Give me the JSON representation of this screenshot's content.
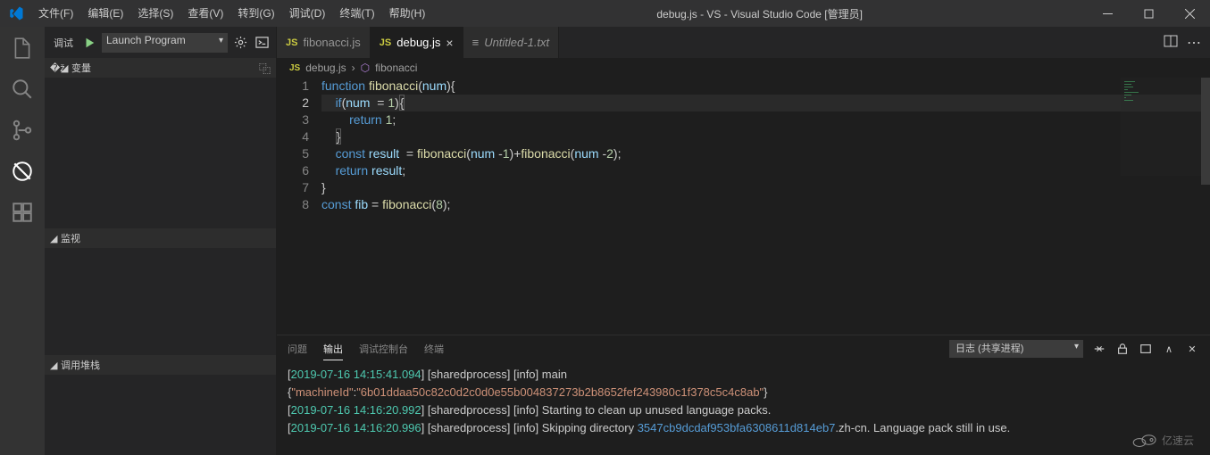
{
  "title": "debug.js - VS - Visual Studio Code [管理员]",
  "menu": [
    "文件(F)",
    "编辑(E)",
    "选择(S)",
    "查看(V)",
    "转到(G)",
    "调试(D)",
    "终端(T)",
    "帮助(H)"
  ],
  "debug": {
    "label": "调试",
    "config": "Launch Program"
  },
  "sections": {
    "vars": "变量",
    "watch": "监视",
    "callstack": "调用堆栈"
  },
  "tabs": [
    {
      "icon": "JS",
      "label": "fibonacci.js",
      "active": false,
      "close": false,
      "italic": false
    },
    {
      "icon": "JS",
      "label": "debug.js",
      "active": true,
      "close": true,
      "italic": false
    },
    {
      "icon": "≡",
      "label": "Untitled-1.txt",
      "active": false,
      "close": false,
      "italic": true
    }
  ],
  "breadcrumb": {
    "file": "debug.js",
    "symbol": "fibonacci"
  },
  "code": {
    "lines": [
      {
        "n": 1,
        "html": "<span class='kw'>function</span> <span class='fn'>fibonacci</span>(<span class='vn'>num</span>){"
      },
      {
        "n": 2,
        "html": "    <span class='kw'>if</span>(<span class='vn'>num</span>  = <span class='nm'>1</span>)<span class='cur-bracket'>{</span>",
        "cur": true
      },
      {
        "n": 3,
        "html": "        <span class='kw'>return</span> <span class='nm'>1</span>;"
      },
      {
        "n": 4,
        "html": "    <span class='cur-bracket'>}</span>"
      },
      {
        "n": 5,
        "html": "    <span class='kw'>const</span> <span class='vn'>result</span>  = <span class='fn'>fibonacci</span>(<span class='vn'>num</span> -<span class='nm'>1</span>)+<span class='fn'>fibonacci</span>(<span class='vn'>num</span> -<span class='nm'>2</span>);"
      },
      {
        "n": 6,
        "html": "    <span class='kw'>return</span> <span class='vn'>result</span>;"
      },
      {
        "n": 7,
        "html": "}"
      },
      {
        "n": 8,
        "html": "<span class='kw'>const</span> <span class='vn'>fib</span> = <span class='fn'>fibonacci</span>(<span class='nm'>8</span>);"
      }
    ]
  },
  "panel": {
    "tabs": [
      "问题",
      "输出",
      "调试控制台",
      "终端"
    ],
    "active": 1,
    "logSelect": "日志 (共享进程)",
    "lines": [
      "[<span class='ts'>2019-07-16 14:15:41.094</span>] [sharedprocess] [info] main",
      "{<span class='key'>\"machineId\"</span>:<span class='str'>\"6b01ddaa50c82c0d2c0d0e55b004837273b2b8652fef243980c1f378c5c4c8ab\"</span>}",
      "[<span class='ts'>2019-07-16 14:16:20.992</span>] [sharedprocess] [info] Starting to clean up unused language packs.",
      "[<span class='ts'>2019-07-16 14:16:20.996</span>] [sharedprocess] [info] Skipping directory <span class='hash'>3547cb9dcdaf953bfa6308611d814eb7</span>.zh-cn. Language pack still in use."
    ]
  },
  "watermark": "亿速云"
}
